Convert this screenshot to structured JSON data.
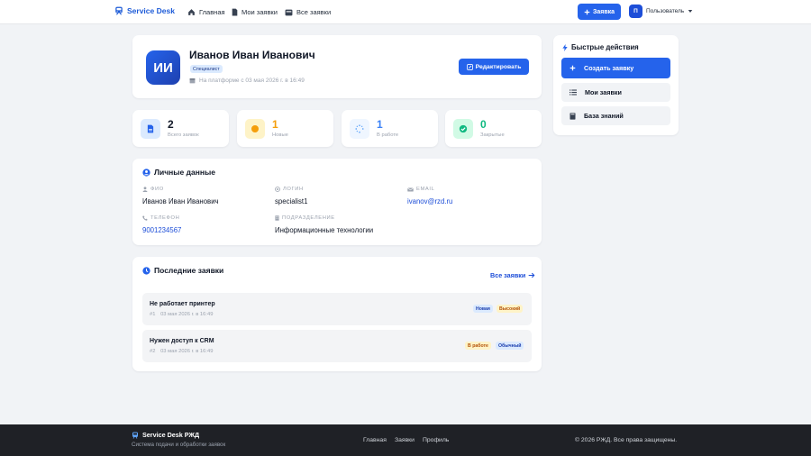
{
  "nav": {
    "brand": "Service Desk",
    "links": [
      "Главная",
      "Мои заявки",
      "Все заявки"
    ],
    "new_request_label": "Заявка",
    "user_initial": "П",
    "user_label": "Пользователь"
  },
  "profile": {
    "initials": "ИИ",
    "name": "Иванов Иван Иванович",
    "role": "Специалист",
    "since": "На платформе с 03 мая 2026 г. в 16:49",
    "edit_label": "Редактировать"
  },
  "stats": [
    {
      "value": "2",
      "label": "Всего заявок",
      "color": "#111827"
    },
    {
      "value": "1",
      "label": "Новые",
      "color": "#f59e0b"
    },
    {
      "value": "1",
      "label": "В работе",
      "color": "#3b82f6"
    },
    {
      "value": "0",
      "label": "Закрытые",
      "color": "#10b981"
    }
  ],
  "quick": {
    "title": "Быстрые действия",
    "actions": [
      "Создать заявку",
      "Мои заявки",
      "База знаний"
    ]
  },
  "personal": {
    "title": "Личные данные",
    "fields": [
      {
        "label": "ФИО",
        "value": "Иванов Иван Иванович"
      },
      {
        "label": "ЛОГИН",
        "value": "specialist1"
      },
      {
        "label": "EMAIL",
        "value": "ivanov@rzd.ru"
      },
      {
        "label": "ТЕЛЕФОН",
        "value": "9001234567"
      },
      {
        "label": "ПОДРАЗДЕЛЕНИЕ",
        "value": "Информационные технологии"
      }
    ]
  },
  "recent": {
    "title": "Последние заявки",
    "all_label": "Все заявки",
    "items": [
      {
        "title": "Не работает принтер",
        "num": "#1",
        "date": "03 мая 2026 г. в 16:49",
        "status": "Новая",
        "priority": "Высокий"
      },
      {
        "title": "Нужен доступ к CRM",
        "num": "#2",
        "date": "03 мая 2026 г. в 16:49",
        "status": "В работе",
        "priority": "Обычный"
      }
    ]
  },
  "footer": {
    "brand": "Service Desk РЖД",
    "subtitle": "Система подачи и обработки заявок",
    "links": [
      "Главная",
      "Заявки",
      "Профиль"
    ],
    "copyright": "© 2026 РЖД. Все права защищены."
  },
  "colors": {
    "accent": "#2563eb",
    "footer_bg": "#1f2126"
  }
}
